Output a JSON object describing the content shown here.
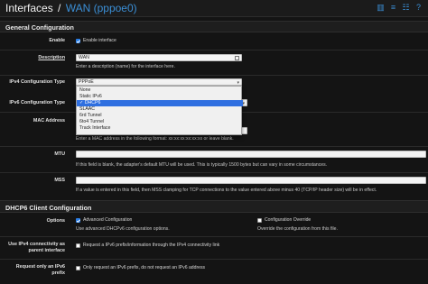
{
  "header": {
    "crumb": "Interfaces",
    "separator": "/",
    "interface": "WAN (pppoe0)"
  },
  "icons": [
    "bar-chart-icon",
    "list-icon",
    "sliders-icon",
    "help-icon"
  ],
  "general": {
    "title": "General Configuration",
    "enable_label": "Enable",
    "enable_text": "Enable interface",
    "enable_checked": true,
    "description_label": "Description",
    "description_value": "WAN",
    "description_help": "Enter a description (name) for the interface here.",
    "ipv4_label": "IPv4 Configuration Type",
    "ipv4_value": "PPPoE",
    "ipv6_label": "IPv6 Configuration Type",
    "mac_label": "MAC Address",
    "mac_help": "Enter a MAC address in the following format: xx:xx:xx:xx:xx:xx or leave blank.",
    "mtu_label": "MTU",
    "mtu_help": "If this field is blank, the adapter's default MTU will be used. This is typically 1500 bytes but can vary in some circumstances.",
    "mss_label": "MSS",
    "mss_help": "If a value is entered in this field, then MSS clamping for TCP connections to the value entered above minus 40 (TCP/IP header size) will be in effect."
  },
  "ipv6_dropdown": {
    "options": [
      "None",
      "Static IPv6",
      "DHCP6",
      "SLAAC",
      "6rd Tunnel",
      "6to4 Tunnel",
      "Track Interface"
    ],
    "selected": "DHCP6",
    "check_mark": "✓"
  },
  "dhcp6": {
    "title": "DHCP6 Client Configuration",
    "options_label": "Options",
    "advanced_text": "Advanced Configuration",
    "advanced_help": "Use advanced DHCPv6 configuration options.",
    "override_text": "Configuration Override",
    "override_help": "Override the configuration from this file.",
    "ipv4conn_label_1": "Use IPv4 connectivity as",
    "ipv4conn_label_2": "parent interface",
    "ipv4conn_text": "Request a IPv6 prefix/information through the IPv4 connectivity link",
    "prefixonly_label_1": "Request only an IPv6",
    "prefixonly_label_2": "prefix",
    "prefixonly_text": "Only request an IPv6 prefix, do not request an IPv6 address"
  }
}
